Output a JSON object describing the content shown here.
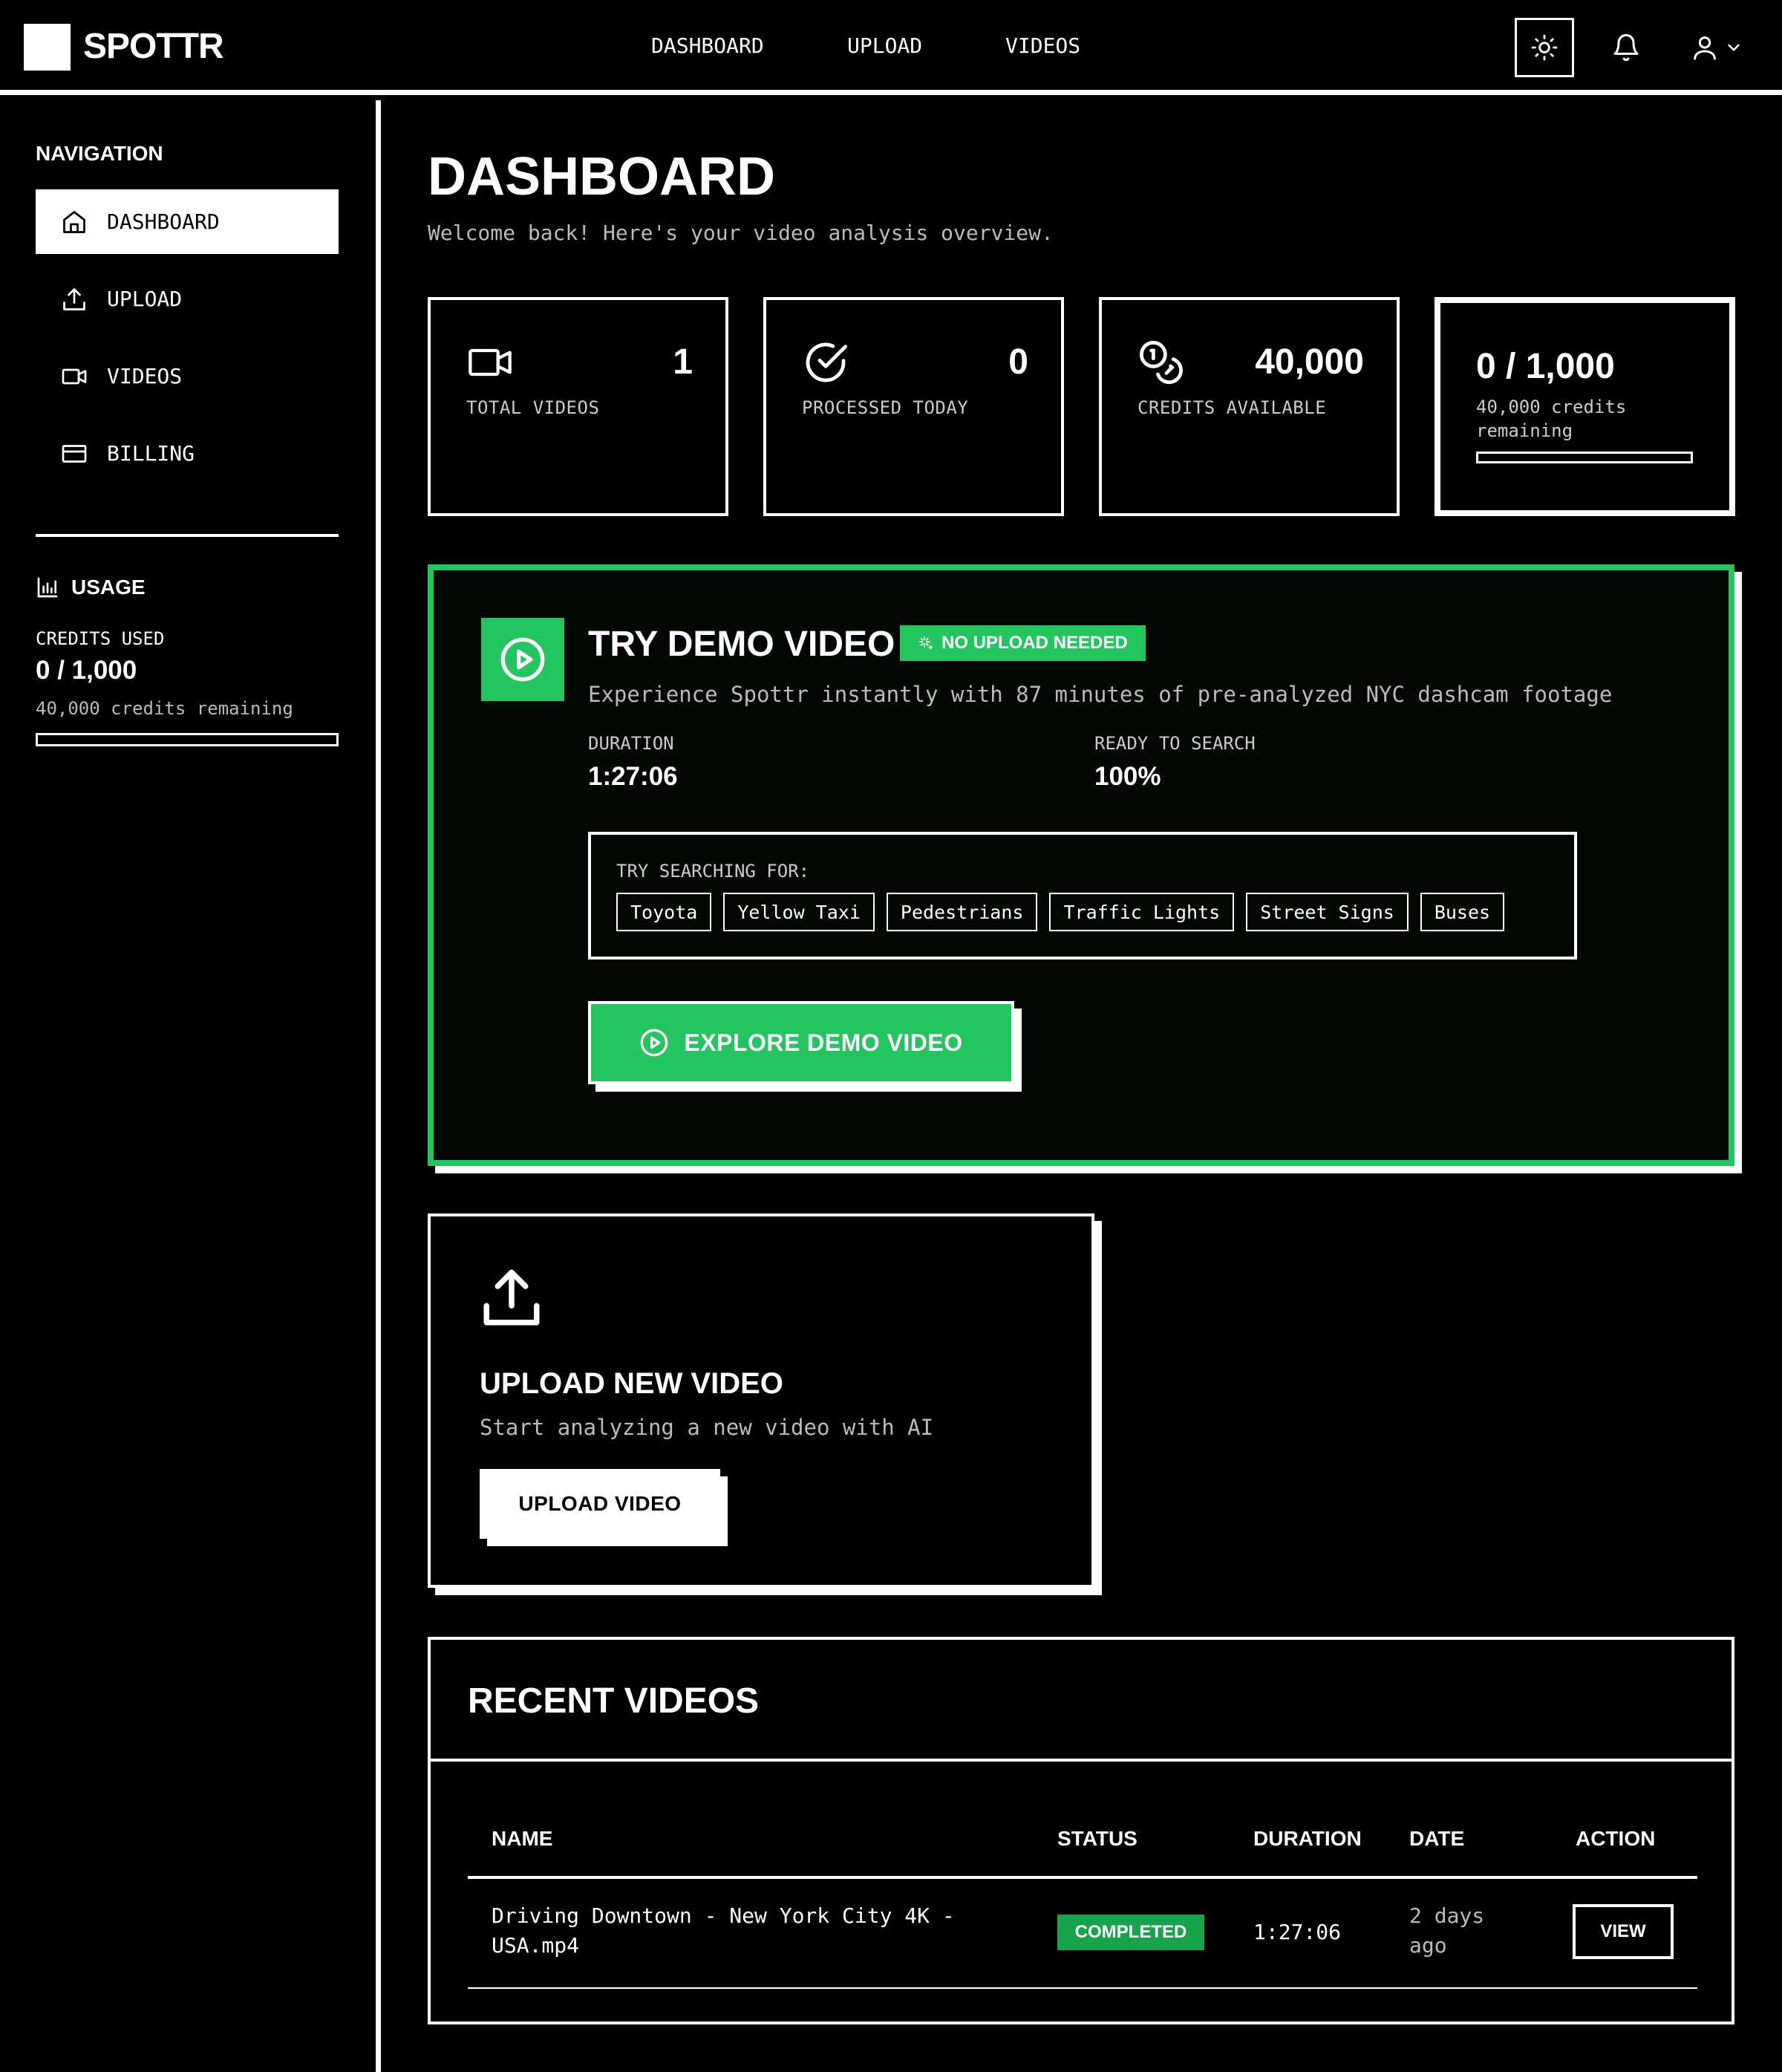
{
  "app": {
    "name": "SPOTTR"
  },
  "topnav": {
    "items": [
      "DASHBOARD",
      "UPLOAD",
      "VIDEOS"
    ]
  },
  "header": {
    "icons": [
      "sun-icon",
      "bell-icon",
      "user-icon",
      "chevron-down-icon"
    ]
  },
  "sidebar": {
    "heading": "NAVIGATION",
    "items": [
      {
        "label": "DASHBOARD",
        "icon": "home-icon",
        "active": true
      },
      {
        "label": "UPLOAD",
        "icon": "upload-icon",
        "active": false
      },
      {
        "label": "VIDEOS",
        "icon": "video-icon",
        "active": false
      },
      {
        "label": "BILLING",
        "icon": "credit-card-icon",
        "active": false
      }
    ],
    "usage": {
      "heading": "USAGE",
      "label": "CREDITS USED",
      "value": "0 / 1,000",
      "remaining": "40,000 credits remaining",
      "progress": 0
    }
  },
  "page": {
    "title": "DASHBOARD",
    "subtitle": "Welcome back! Here's your video analysis overview."
  },
  "stats": [
    {
      "icon": "video-icon",
      "value": "1",
      "label": "TOTAL VIDEOS"
    },
    {
      "icon": "check-circle-icon",
      "value": "0",
      "label": "PROCESSED TODAY"
    },
    {
      "icon": "coins-icon",
      "value": "40,000",
      "label": "CREDITS AVAILABLE"
    },
    {
      "value": "0 / 1,000",
      "sub": "40,000 credits remaining",
      "progress": 0
    }
  ],
  "demo": {
    "title": "TRY DEMO VIDEO",
    "badge": "NO UPLOAD NEEDED",
    "description": "Experience Spottr instantly with 87 minutes of pre-analyzed NYC dashcam footage",
    "duration_label": "DURATION",
    "duration_value": "1:27:06",
    "ready_label": "READY TO SEARCH",
    "ready_value": "100%",
    "suggest_label": "TRY SEARCHING FOR:",
    "chips": [
      "Toyota",
      "Yellow Taxi",
      "Pedestrians",
      "Traffic Lights",
      "Street Signs",
      "Buses"
    ],
    "button": "EXPLORE DEMO VIDEO",
    "accent": "#22c55e"
  },
  "upload": {
    "title": "UPLOAD NEW VIDEO",
    "description": "Start analyzing a new video with AI",
    "button": "UPLOAD VIDEO"
  },
  "recent": {
    "title": "RECENT VIDEOS",
    "columns": [
      "NAME",
      "STATUS",
      "DURATION",
      "DATE",
      "ACTION"
    ],
    "rows": [
      {
        "name_line1": "Driving Downtown - New York City 4K -",
        "name_line2": "USA.mp4",
        "status": "COMPLETED",
        "duration": "1:27:06",
        "date_line1": "2 days",
        "date_line2": "ago",
        "action": "VIEW"
      }
    ]
  }
}
